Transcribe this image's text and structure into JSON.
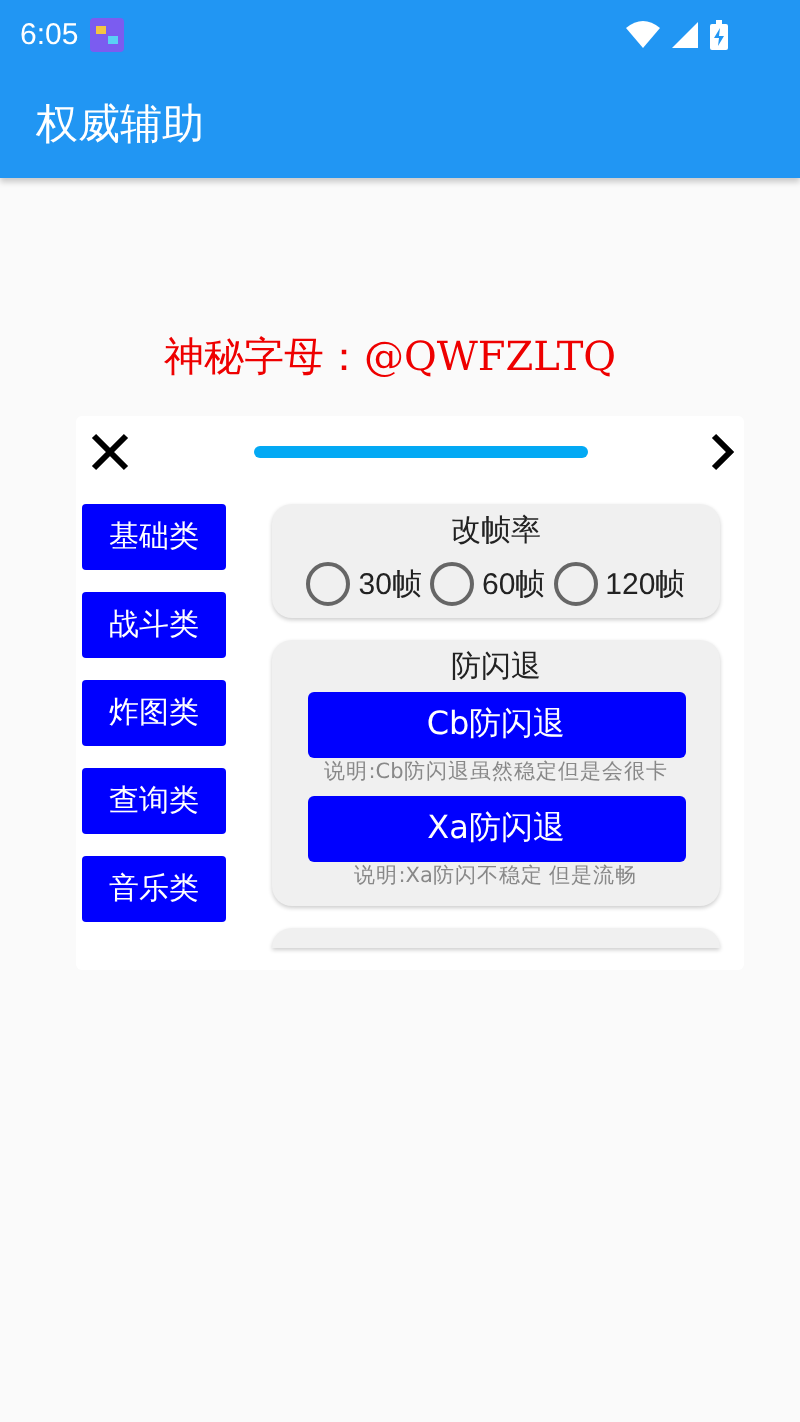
{
  "status_bar": {
    "time": "6:05"
  },
  "app_bar": {
    "title": "权威辅助"
  },
  "banner": {
    "text": "神秘字母：@QWFZLTQ"
  },
  "panel": {
    "categories": [
      {
        "label": "基础类",
        "selected": false
      },
      {
        "label": "战斗类",
        "selected": false
      },
      {
        "label": "炸图类",
        "selected": false
      },
      {
        "label": "查询类",
        "selected": false
      },
      {
        "label": "音乐类",
        "selected": false
      }
    ],
    "frame_rate": {
      "title": "改帧率",
      "options": [
        {
          "label": "30帧",
          "checked": false
        },
        {
          "label": "60帧",
          "checked": false
        },
        {
          "label": "120帧",
          "checked": false
        }
      ]
    },
    "anti_flash": {
      "title": "防闪退",
      "buttons": [
        {
          "label": "Cb防闪退",
          "note": "说明:Cb防闪退虽然稳定但是会很卡"
        },
        {
          "label": "Xa防闪退",
          "note": "说明:Xa防闪不稳定 但是流畅"
        }
      ]
    }
  }
}
